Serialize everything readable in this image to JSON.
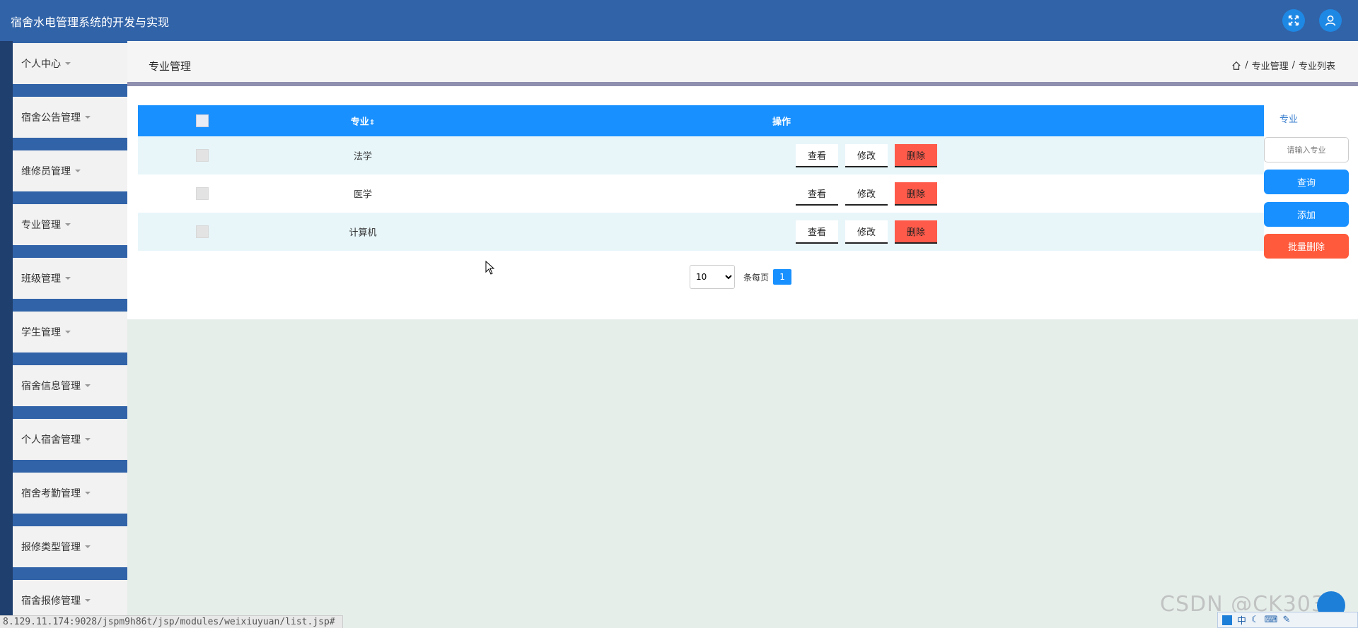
{
  "app": {
    "title": "宿舍水电管理系统的开发与实现"
  },
  "sidebar": {
    "items": [
      {
        "label": "个人中心"
      },
      {
        "label": "宿舍公告管理"
      },
      {
        "label": "维修员管理"
      },
      {
        "label": "专业管理"
      },
      {
        "label": "班级管理"
      },
      {
        "label": "学生管理"
      },
      {
        "label": "宿舍信息管理"
      },
      {
        "label": "个人宿舍管理"
      },
      {
        "label": "宿舍考勤管理"
      },
      {
        "label": "报修类型管理"
      },
      {
        "label": "宿舍报修管理"
      }
    ]
  },
  "header": {
    "page_title": "专业管理",
    "breadcrumb": [
      "专业管理",
      "专业列表"
    ],
    "sep": "/"
  },
  "table": {
    "columns": {
      "major": "专业",
      "sort_icon": "⇕",
      "ops": "操作"
    },
    "rows": [
      {
        "major": "法学"
      },
      {
        "major": "医学"
      },
      {
        "major": "计算机"
      }
    ],
    "actions": {
      "view": "查看",
      "edit": "修改",
      "delete": "删除"
    }
  },
  "pager": {
    "page_size": "10",
    "per_page_label": "条每页",
    "current_page": "1"
  },
  "filter": {
    "label": "专业",
    "placeholder": "请输入专业",
    "query_label": "查询",
    "add_label": "添加",
    "batch_delete_label": "批量删除"
  },
  "statusbar": {
    "url": "8.129.11.174:9028/jspm9h86t/jsp/modules/weixiuyuan/list.jsp#"
  },
  "watermark": {
    "text": "CSDN @CK3034"
  },
  "tray": {
    "ime": "中"
  },
  "colors": {
    "topbar": "#3163a8",
    "primary": "#1890ff",
    "danger": "#ff5a4a",
    "row_alt": "#e8f6fa"
  },
  "icons": {
    "top_right": [
      "fullscreen-icon",
      "user-avatar-icon"
    ],
    "breadcrumb": "home-icon"
  }
}
